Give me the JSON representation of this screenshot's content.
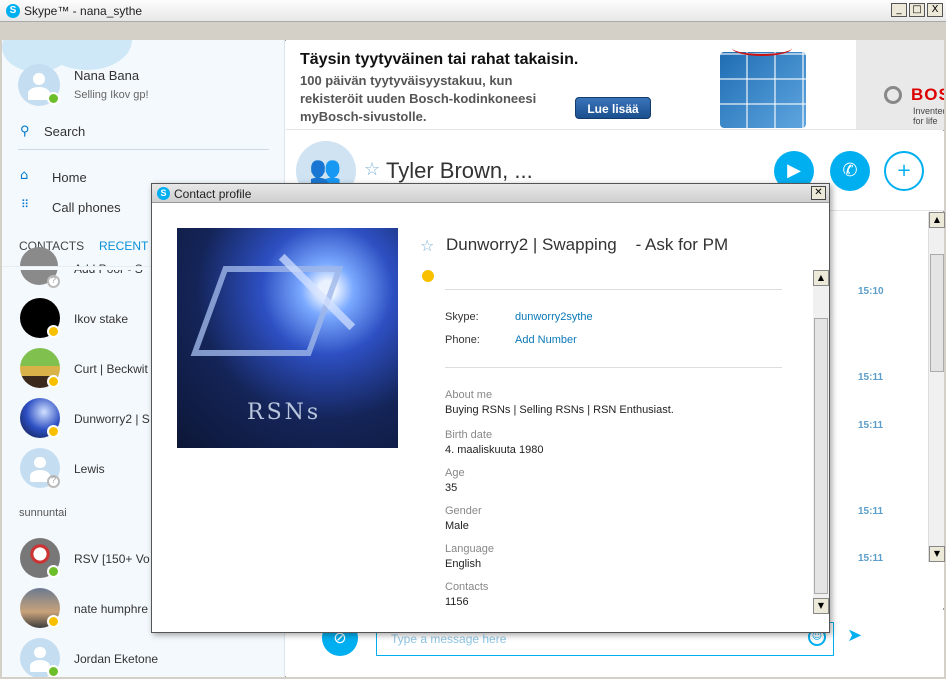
{
  "window": {
    "title": "Skype™ - nana_sythe",
    "min_label": "_",
    "max_label": "□",
    "close_label": "X"
  },
  "sidebar": {
    "profile": {
      "name": "Nana Bana",
      "mood": "Selling Ikov gp!"
    },
    "search_label": "Search",
    "nav": [
      {
        "label": "Home",
        "icon": "home-icon"
      },
      {
        "label": "Call phones",
        "icon": "dialpad-icon"
      }
    ],
    "tabs": [
      "CONTACTS",
      "RECENT"
    ],
    "contacts": [
      {
        "name": "Add Poor - S",
        "status": "unknown"
      },
      {
        "name": "Ikov stake",
        "status": "away"
      },
      {
        "name": "Curt | Beckwit",
        "status": "away"
      },
      {
        "name": "Dunworry2 | S",
        "status": "away"
      },
      {
        "name": "Lewis",
        "status": "unknown"
      }
    ],
    "section_label": "sunnuntai",
    "contacts_older": [
      {
        "name": "RSV [150+ Vo",
        "status": "online"
      },
      {
        "name": "nate humphre",
        "status": "away"
      },
      {
        "name": "Jordan Eketone",
        "status": "online"
      }
    ]
  },
  "ad": {
    "headline": "Täysin tyytyväinen tai rahat takaisin.",
    "body_lines": [
      "100 päivän tyytyväisyystakuu, kun",
      "rekisteröit uuden Bosch-kodinkoneesi",
      "myBosch-sivustolle."
    ],
    "cta": "Lue lisää",
    "brand": "BOSCH",
    "tagline": "Invented for life"
  },
  "conversation": {
    "title": "Tyler Brown, ...",
    "buttons": [
      "video-call-button",
      "call-button",
      "add-contact-button"
    ],
    "timestamps": [
      "15:10",
      "15:11",
      "15:11",
      "15:11",
      "15:11"
    ]
  },
  "composer": {
    "placeholder": "Type a message here"
  },
  "dialog": {
    "title": "Contact profile",
    "display_name": "Dunworry2 | Swapping    - Ask for PM",
    "image_text": "RSNs",
    "skype_label": "Skype:",
    "skype_value": "dunworry2sythe",
    "phone_label": "Phone:",
    "phone_value": "Add Number",
    "fields": [
      {
        "label": "About me",
        "value": "Buying RSNs | Selling RSNs | RSN Enthusiast."
      },
      {
        "label": "Birth date",
        "value": "4. maaliskuuta 1980"
      },
      {
        "label": "Age",
        "value": "35"
      },
      {
        "label": "Gender",
        "value": "Male"
      },
      {
        "label": "Language",
        "value": "English"
      },
      {
        "label": "Contacts",
        "value": "1156"
      }
    ]
  },
  "colors": {
    "skype_blue": "#00aff0",
    "online": "#6cbf2a",
    "away": "#f8c000",
    "link": "#0a78b8"
  }
}
